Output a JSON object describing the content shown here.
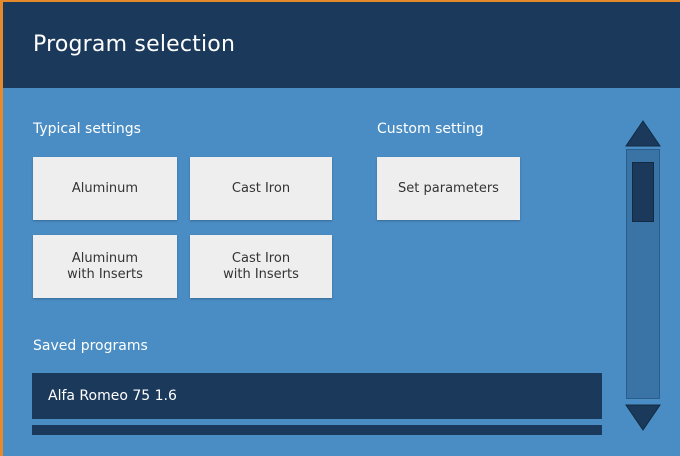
{
  "title": "Program selection",
  "sections": {
    "typical_label": "Typical settings",
    "custom_label": "Custom setting",
    "saved_label": "Saved programs"
  },
  "typical": [
    {
      "label": "Aluminum"
    },
    {
      "label": "Cast Iron"
    },
    {
      "label": "Aluminum\nwith Inserts"
    },
    {
      "label": "Cast Iron\nwith Inserts"
    }
  ],
  "custom": [
    {
      "label": "Set parameters"
    }
  ],
  "saved_programs": [
    {
      "name": "Alfa Romeo 75 1.6"
    }
  ],
  "icons": {
    "scroll_up": "triangle-up-icon",
    "scroll_down": "triangle-down-icon"
  },
  "colors": {
    "accent_border": "#e58a2a",
    "header_bg": "#1b3a5b",
    "panel_bg": "#4a8dc4",
    "tile_bg": "#eeeeee"
  }
}
